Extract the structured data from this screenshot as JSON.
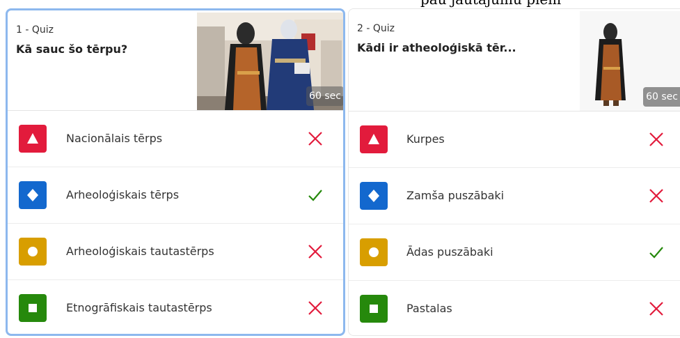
{
  "header_strip": "pau jautājumu piem",
  "colors": {
    "triangle": "#e21b3c",
    "diamond": "#1368ce",
    "circle": "#d89e00",
    "square": "#26890c",
    "wrong": "#e21b3c",
    "correct": "#26890c"
  },
  "quizzes": [
    {
      "number": "1 - Quiz",
      "title": "Kā sauc šo tērpu?",
      "timer": "60 sec",
      "image_icon": "museum-mannequins-image",
      "answers": [
        {
          "shape": "triangle",
          "text": "Nacionālais tērps",
          "correct": false
        },
        {
          "shape": "diamond",
          "text": "Arheoloģiskais tērps",
          "correct": true
        },
        {
          "shape": "circle",
          "text": "Arheoloģiskais tautastērps",
          "correct": false
        },
        {
          "shape": "square",
          "text": "Etnogrāfiskais tautastērps",
          "correct": false
        }
      ]
    },
    {
      "number": "2 - Quiz",
      "title": "Kādi ir atheoloģiskā tēr...",
      "timer": "60 sec",
      "image_icon": "costume-person-image",
      "answers": [
        {
          "shape": "triangle",
          "text": "Kurpes",
          "correct": false
        },
        {
          "shape": "diamond",
          "text": "Zamša puszābaki",
          "correct": false
        },
        {
          "shape": "circle",
          "text": "Ādas puszābaki",
          "correct": true
        },
        {
          "shape": "square",
          "text": "Pastalas",
          "correct": false
        }
      ]
    }
  ]
}
